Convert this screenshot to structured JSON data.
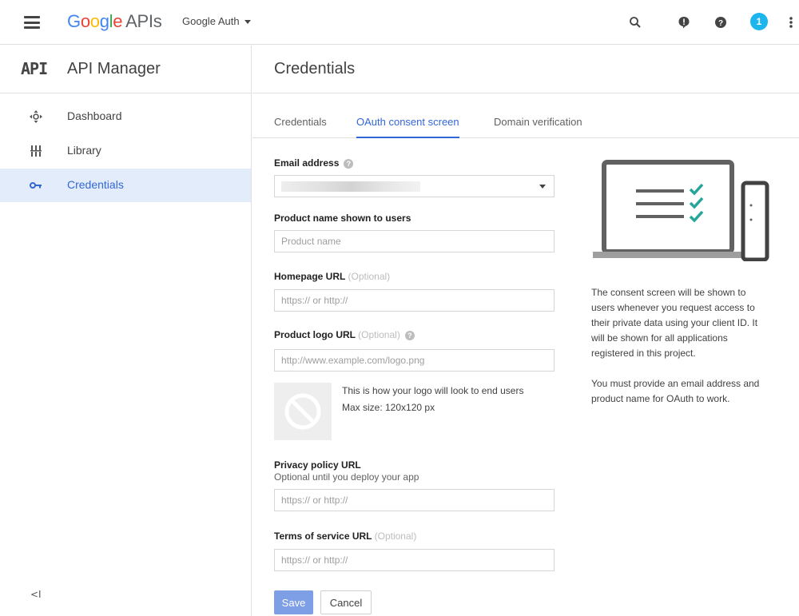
{
  "topbar": {
    "brand": {
      "g1": "G",
      "g2": "o",
      "g3": "o",
      "g4": "g",
      "g5": "l",
      "g6": "e",
      "apis": "APIs"
    },
    "project": "Google Auth",
    "notification_count": "1",
    "icons": [
      "search-icon",
      "feedback-icon",
      "help-icon",
      "notifications-icon",
      "more-vert-icon"
    ]
  },
  "sidebar": {
    "logo": "API",
    "title": "API Manager",
    "items": [
      {
        "label": "Dashboard",
        "icon": "dashboard-icon"
      },
      {
        "label": "Library",
        "icon": "library-icon"
      },
      {
        "label": "Credentials",
        "icon": "key-icon",
        "active": true
      }
    ],
    "collapse": "<I"
  },
  "main": {
    "title": "Credentials",
    "tabs": [
      {
        "label": "Credentials"
      },
      {
        "label": "OAuth consent screen",
        "active": true
      },
      {
        "label": "Domain verification"
      }
    ],
    "form": {
      "email_label": "Email address",
      "product_label": "Product name shown to users",
      "product_placeholder": "Product name",
      "homepage_label": "Homepage URL",
      "optional": "(Optional)",
      "url_placeholder": "https:// or http://",
      "logo_label": "Product logo URL",
      "logo_placeholder": "http://www.example.com/logo.png",
      "logo_note_1": "This is how your logo will look to end users",
      "logo_note_2": "Max size: 120x120 px",
      "privacy_label": "Privacy policy URL",
      "privacy_sub": "Optional until you deploy your app",
      "tos_label": "Terms of service URL",
      "save": "Save",
      "cancel": "Cancel"
    },
    "info": {
      "p1": "The consent screen will be shown to users whenever you request access to their private data using your client ID. It will be shown for all applications registered in this project.",
      "p2": "You must provide an email address and product name for OAuth to work."
    }
  },
  "colors": {
    "accent": "#3367d6",
    "check": "#26a69a",
    "notification": "#1db5ee",
    "save_disabled": "#7e9ee6"
  }
}
